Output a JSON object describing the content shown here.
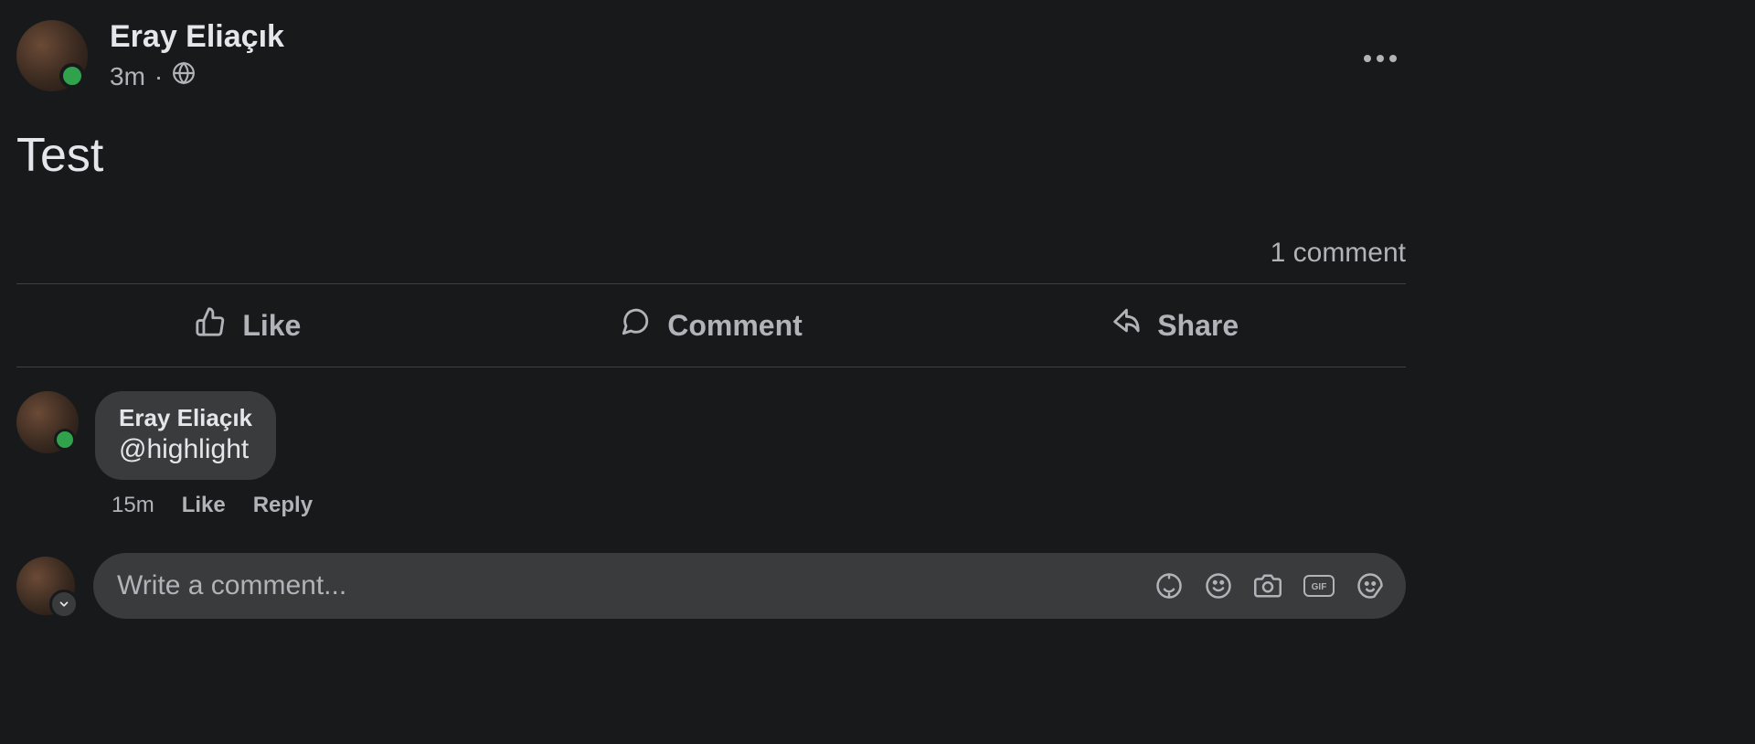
{
  "post": {
    "author": "Eray Eliaçık",
    "timestamp": "3m",
    "privacy_separator": "·",
    "content": "Test",
    "comment_count_label": "1 comment"
  },
  "actions": {
    "like": "Like",
    "comment": "Comment",
    "share": "Share"
  },
  "comments": [
    {
      "author": "Eray Eliaçık",
      "text": "@highlight",
      "timestamp": "15m",
      "like_label": "Like",
      "reply_label": "Reply"
    }
  ],
  "composer": {
    "placeholder": "Write a comment..."
  }
}
